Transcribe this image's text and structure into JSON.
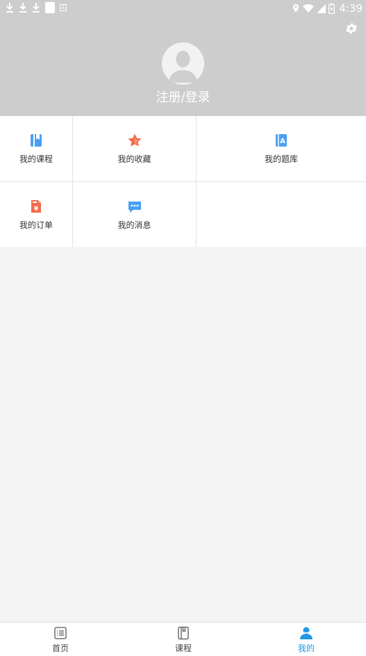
{
  "status_bar": {
    "time": "4:39"
  },
  "header": {
    "login_label": "注册/登录",
    "settings_icon": "gear-icon",
    "avatar_icon": "user-silhouette-icon"
  },
  "grid": {
    "items": [
      {
        "label": "我的课程",
        "icon": "book-icon",
        "color": "#4a9ff5"
      },
      {
        "label": "我的收藏",
        "icon": "star-icon",
        "color": "#f26b4a"
      },
      {
        "label": "我的题库",
        "icon": "question-bank-icon",
        "color": "#4a9ff5"
      },
      {
        "label": "我的订单",
        "icon": "order-icon",
        "color": "#f26b4a"
      },
      {
        "label": "我的消息",
        "icon": "message-icon",
        "color": "#4a9ff5"
      }
    ]
  },
  "tabbar": {
    "tabs": [
      {
        "label": "首页",
        "icon": "home-list-icon",
        "active": false
      },
      {
        "label": "课程",
        "icon": "course-book-icon",
        "active": false
      },
      {
        "label": "我的",
        "icon": "profile-icon",
        "active": true
      }
    ],
    "active_color": "#2196e6"
  }
}
